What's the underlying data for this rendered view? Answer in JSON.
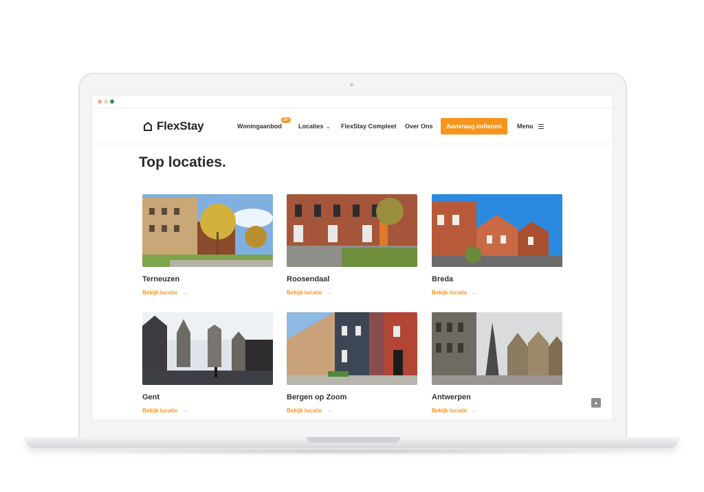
{
  "brand": {
    "name": "FlexStay",
    "accent": "#f7941d"
  },
  "nav": {
    "woningaanbod": "Woningaanbod",
    "woningaanbod_badge": "10+",
    "locaties": "Locaties",
    "compleet": "FlexStay Compleet",
    "over_ons": "Over Ons",
    "cta": "Aanvraag indienen",
    "menu": "Menu"
  },
  "page": {
    "title": "Top locaties."
  },
  "locations": [
    {
      "name": "Terneuzen",
      "link": "Bekijk locatie"
    },
    {
      "name": "Roosendaal",
      "link": "Bekijk locatie"
    },
    {
      "name": "Breda",
      "link": "Bekijk locatie"
    },
    {
      "name": "Gent",
      "link": "Bekijk locatie"
    },
    {
      "name": "Bergen op Zoom",
      "link": "Bekijk locatie"
    },
    {
      "name": "Antwerpen",
      "link": "Bekijk locatie"
    }
  ],
  "icons": {
    "logo": "house-icon",
    "chevron": "chevron-down-icon",
    "menu": "hamburger-icon",
    "arrow": "arrow-right-icon",
    "scroll_top": "chevron-up-icon"
  }
}
